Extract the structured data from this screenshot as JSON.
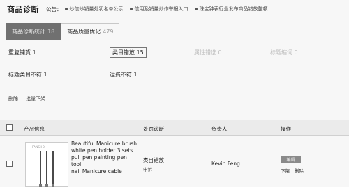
{
  "header": {
    "title": "商品诊断",
    "notice_label": "公告：",
    "notices": [
      "炒信炒销量处罚名单公示",
      "信用及销量炒作举报入口",
      "珠宝钟表行业发布商品错放整顿"
    ]
  },
  "tabs": [
    {
      "label": "商品诊断统计",
      "count": "18"
    },
    {
      "label": "商品质量优化",
      "count": "479"
    }
  ],
  "filters": {
    "repeat": "重复铺货 1",
    "category": "类目错放 15",
    "attribute": "属性错选 0",
    "title_short": "标题缩词 0",
    "title_mismatch": "标题类目不符 1",
    "shipping": "运费不符 1"
  },
  "actions": {
    "delete": "删除",
    "bulk_delist": "批量下架"
  },
  "table": {
    "headers": {
      "product": "产品信息",
      "diagnosis": "处罚诊断",
      "owner": "负责人",
      "operation": "操作"
    },
    "rows": [
      {
        "thumb_brand": "FANSHO",
        "name": "Beautiful Manicure brush\nwhite pen holder 3 sets\npull pen painting pen tool\nnail Manicure cable",
        "diagnosis": "类目错放",
        "appeal": "申诉",
        "owner": "Kevin Feng",
        "edit": "编辑",
        "delist": "下架",
        "delete": "删除"
      }
    ]
  }
}
